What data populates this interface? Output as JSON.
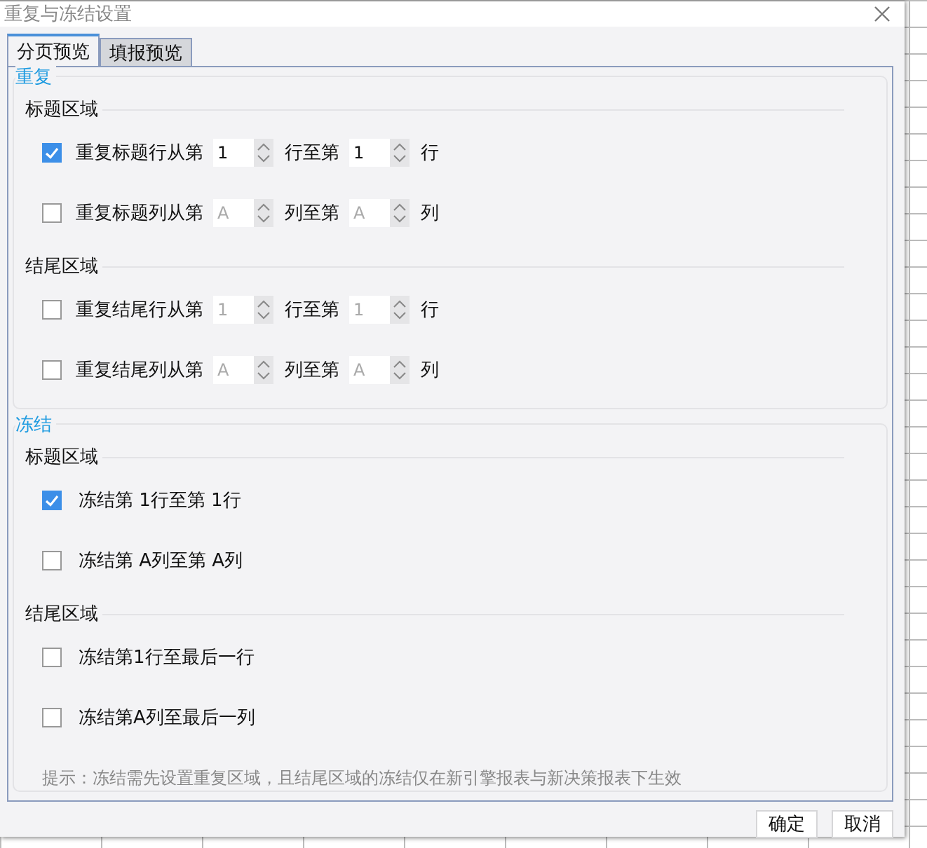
{
  "window": {
    "title": "重复与冻结设置"
  },
  "tabs": [
    {
      "label": "分页预览",
      "selected": true
    },
    {
      "label": "填报预览",
      "selected": false
    }
  ],
  "repeat": {
    "title": "重复",
    "groups": [
      {
        "title": "标题区域",
        "rows": [
          {
            "checked": true,
            "label": "重复标题行从第",
            "from": "1",
            "mid": "行至第",
            "to": "1",
            "end": "行"
          },
          {
            "checked": false,
            "label": "重复标题列从第",
            "from": "A",
            "mid": "列至第",
            "to": "A",
            "end": "列"
          }
        ]
      },
      {
        "title": "结尾区域",
        "rows": [
          {
            "checked": false,
            "label": "重复结尾行从第",
            "from": "1",
            "mid": "行至第",
            "to": "1",
            "end": "行"
          },
          {
            "checked": false,
            "label": "重复结尾列从第",
            "from": "A",
            "mid": "列至第",
            "to": "A",
            "end": "列"
          }
        ]
      }
    ]
  },
  "freeze": {
    "title": "冻结",
    "groups": [
      {
        "title": "标题区域",
        "rows": [
          {
            "checked": true,
            "label": "冻结第 1行至第 1行"
          },
          {
            "checked": false,
            "label": "冻结第 A列至第 A列"
          }
        ]
      },
      {
        "title": "结尾区域",
        "rows": [
          {
            "checked": false,
            "label": "冻结第1行至最后一行"
          },
          {
            "checked": false,
            "label": "冻结第A列至最后一列"
          }
        ]
      }
    ],
    "hint": "提示：冻结需先设置重复区域，且结尾区域的冻结仅在新引擎报表与新决策报表下生效"
  },
  "buttons": [
    "确定",
    "取消"
  ]
}
